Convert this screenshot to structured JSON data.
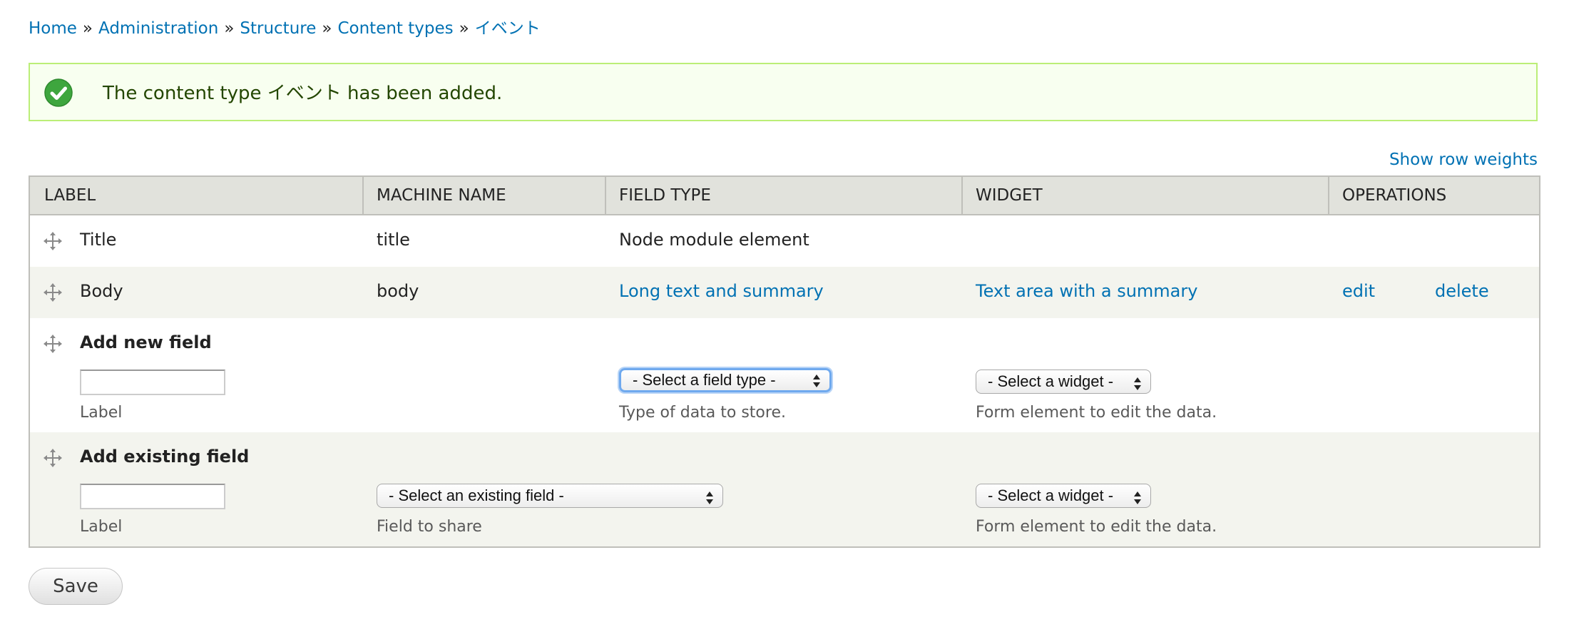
{
  "breadcrumb": {
    "items": [
      "Home",
      "Administration",
      "Structure",
      "Content types",
      "イベント"
    ],
    "separator": "»"
  },
  "message": {
    "text": "The content type イベント has been added.",
    "icon": "check-circle-icon",
    "color": "#3ea63e"
  },
  "show_row_weights": "Show row weights",
  "table": {
    "headers": [
      "LABEL",
      "MACHINE NAME",
      "FIELD TYPE",
      "WIDGET",
      "OPERATIONS"
    ],
    "rows": [
      {
        "label": "Title",
        "machine_name": "title",
        "field_type": "Node module element"
      },
      {
        "label": "Body",
        "machine_name": "body",
        "field_type": "Long text and summary",
        "widget": "Text area with a summary",
        "edit": "edit",
        "delete": "delete"
      }
    ],
    "add_new": {
      "title": "Add new field",
      "label_value": "",
      "label_desc": "Label",
      "field_type_select": "- Select a field type -",
      "field_type_desc": "Type of data to store.",
      "widget_select": "- Select a widget -",
      "widget_desc": "Form element to edit the data."
    },
    "add_existing": {
      "title": "Add existing field",
      "label_value": "",
      "label_desc": "Label",
      "existing_select": "- Select an existing field -",
      "existing_desc": "Field to share",
      "widget_select": "- Select a widget -",
      "widget_desc": "Form element to edit the data."
    }
  },
  "save_label": "Save",
  "colors": {
    "link": "#0071b3",
    "header_bg": "#e1e2dc",
    "row_alt": "#f3f4ee",
    "message_bg": "#f8fff0",
    "message_border": "#bbee77"
  }
}
